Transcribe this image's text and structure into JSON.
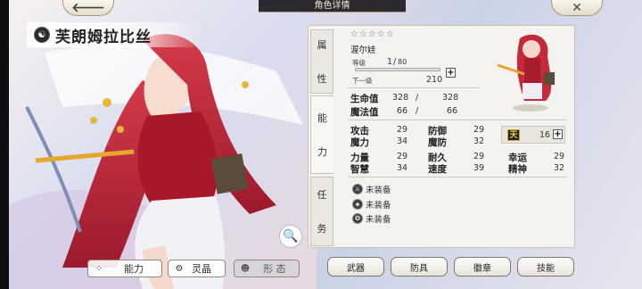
{
  "header": {
    "title": "角色详情",
    "back_icon": "arrow-left-icon",
    "close_icon": "close-x-icon"
  },
  "character": {
    "name": "芙朗姆拉比丝",
    "class_icon": "yin-yang-icon"
  },
  "side_tabs": [
    {
      "label_1": "属",
      "label_2": "性"
    },
    {
      "label_1": "能",
      "label_2": "力"
    },
    {
      "label_1": "任",
      "label_2": "务"
    }
  ],
  "attributes": {
    "stars": "☆☆☆☆☆",
    "title_name": "渥尔娃",
    "level_label": "等级",
    "level": "1",
    "level_sep": "/",
    "level_max": "80",
    "level_progress": 0.0,
    "next_label": "下一级",
    "next_value": "210"
  },
  "vitals": [
    {
      "label": "生命值",
      "current": "328",
      "sep": "/",
      "max": "328"
    },
    {
      "label": "魔法值",
      "current": "66",
      "sep": "/",
      "max": "66"
    }
  ],
  "stats": {
    "col1": [
      {
        "label": "攻击",
        "value": "29"
      },
      {
        "label": "魔力",
        "value": "34"
      },
      {
        "label": "力量",
        "value": "29"
      },
      {
        "label": "智慧",
        "value": "34"
      }
    ],
    "col2": [
      {
        "label": "防御",
        "value": "29"
      },
      {
        "label": "魔防",
        "value": "32"
      },
      {
        "label": "耐久",
        "value": "29"
      },
      {
        "label": "速度",
        "value": "39"
      }
    ],
    "col3": [
      {
        "label": "幸运",
        "value": "29"
      },
      {
        "label": "精神",
        "value": "32"
      }
    ],
    "bonus_badge": "天",
    "bonus_points": "16"
  },
  "equipment": [
    {
      "label": "未装备"
    },
    {
      "label": "未装备"
    },
    {
      "label": "未装备"
    }
  ],
  "bottom_tabs": {
    "ability": "能力",
    "spirit": "灵晶",
    "form": "形 态"
  },
  "equip_buttons": [
    "武器",
    "防具",
    "徽章",
    "技能"
  ],
  "colors": {
    "accent_gold": "#bcae86",
    "panel_bg": "#f4f3ef"
  }
}
